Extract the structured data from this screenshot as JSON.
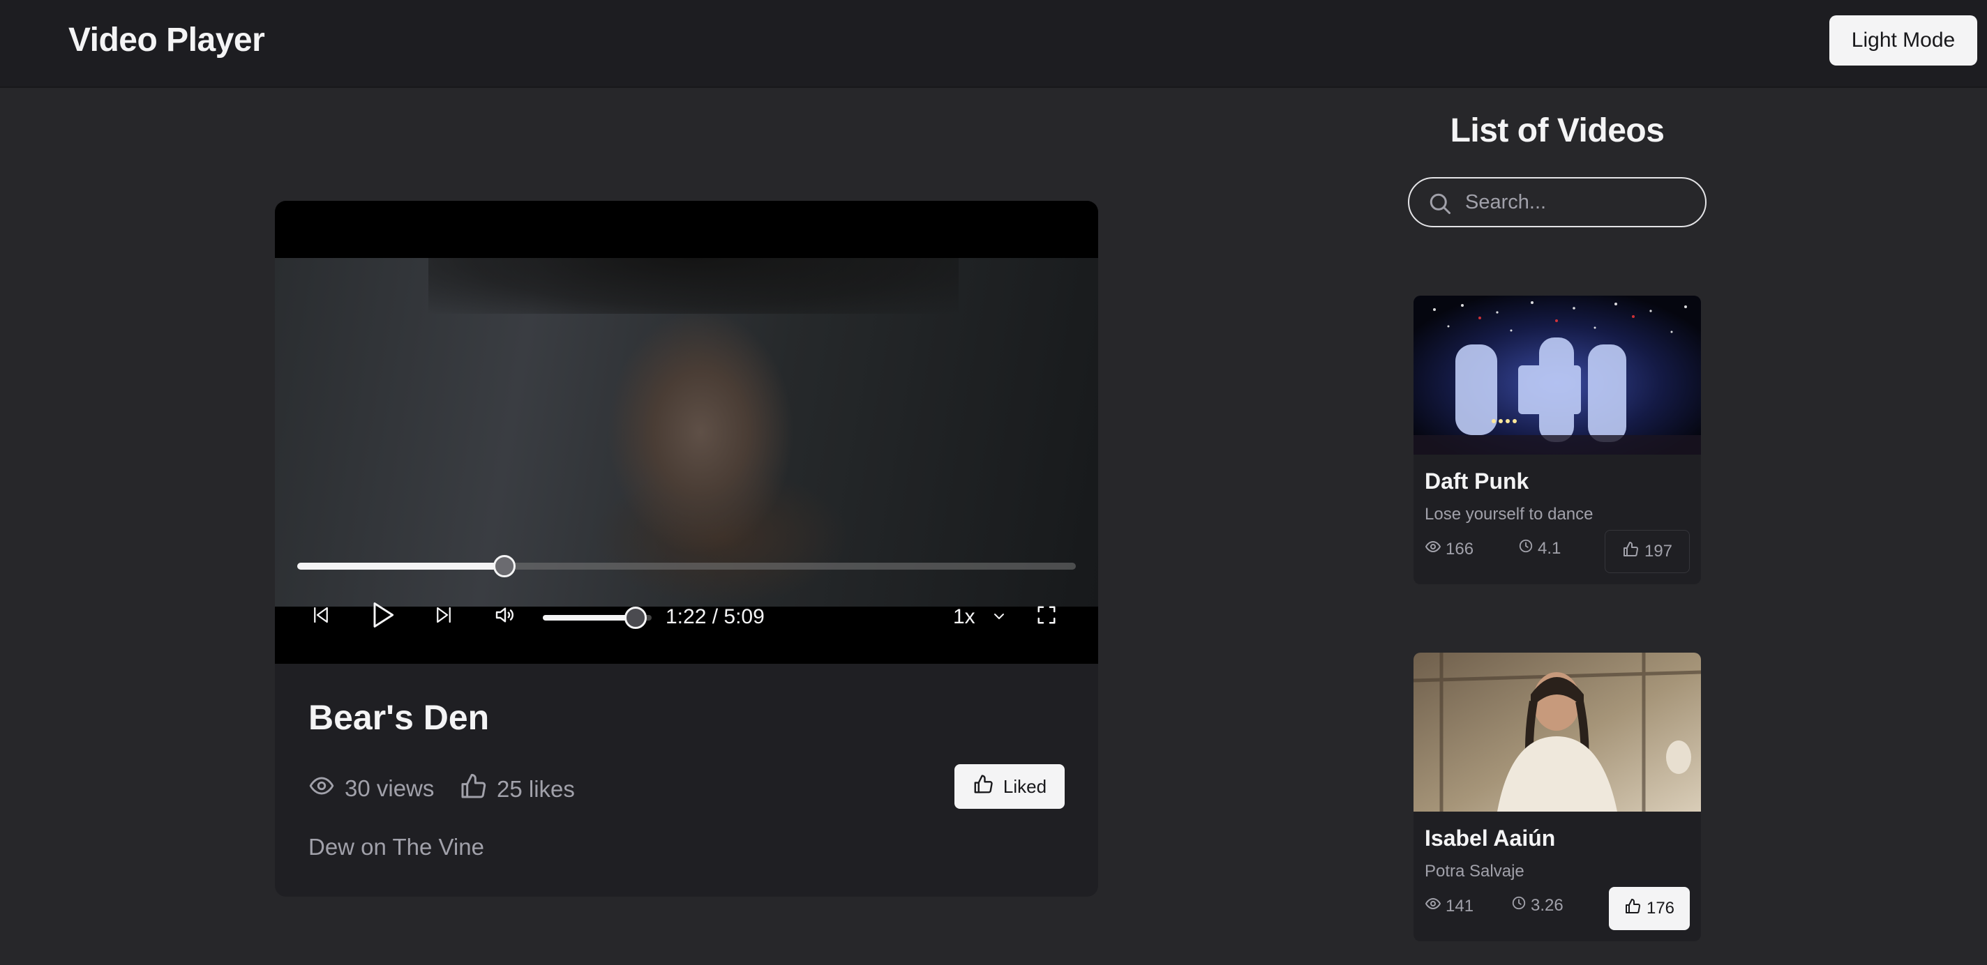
{
  "header": {
    "title": "Video Player",
    "theme_button": "Light Mode"
  },
  "player": {
    "progress_fraction": 0.2665,
    "volume_fraction": 0.85,
    "time": "1:22 / 5:09",
    "speed": "1x",
    "title": "Bear's Den",
    "views": "30 views",
    "likes": "25 likes",
    "liked_label": "Liked",
    "description": "Dew on The Vine",
    "icons": {
      "prev": "skip-back-icon",
      "play": "play-icon",
      "next": "skip-forward-icon",
      "volume": "volume-icon",
      "speed": "chevron-down-icon",
      "fullscreen": "fullscreen-icon",
      "views": "eye-icon",
      "likes": "thumbs-up-icon"
    }
  },
  "sidebar": {
    "title": "List of Videos",
    "search_placeholder": "Search...",
    "videos": [
      {
        "name": "Daft Punk",
        "subtitle": "Lose yourself to dance",
        "views": "166",
        "duration": "4.1",
        "likes": "197",
        "liked": false
      },
      {
        "name": "Isabel Aaiún",
        "subtitle": "Potra Salvaje",
        "views": "141",
        "duration": "3.26",
        "likes": "176",
        "liked": true
      }
    ]
  },
  "colors": {
    "page_bg": "#27272a",
    "header_bg": "#1d1d21",
    "card_bg": "#1f1f23",
    "text_primary": "#f4f4f5",
    "text_muted": "#a1a1aa"
  }
}
